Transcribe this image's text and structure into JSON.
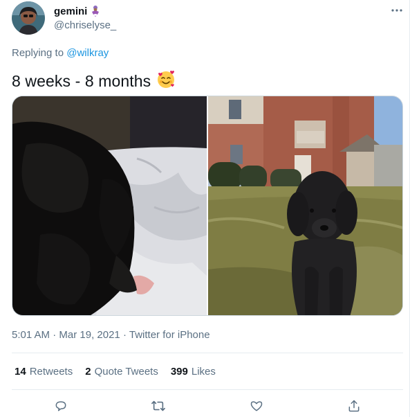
{
  "author": {
    "display_name": "gemini",
    "handle": "@chriselyse_",
    "name_emoji": "genie-emoji-icon"
  },
  "reply": {
    "prefix": "Replying to",
    "mention": "@wilkray"
  },
  "tweet": {
    "text": "8 weeks - 8 months",
    "emoji": "smiling-face-with-hearts-icon"
  },
  "media": {
    "photo_left": "black puppy lying on white bedding",
    "photo_right": "grown black doodle dog sitting on grass in front of brick apartment building"
  },
  "meta": {
    "time": "5:01 AM",
    "separator": "·",
    "date": "Mar 19, 2021",
    "source": "Twitter for iPhone"
  },
  "stats": {
    "retweets_num": "14",
    "retweets_label": "Retweets",
    "quotes_num": "2",
    "quotes_label": "Quote Tweets",
    "likes_num": "399",
    "likes_label": "Likes"
  },
  "colors": {
    "link": "#1b95e0",
    "secondary_text": "#5b7083",
    "primary_text": "#0f1419",
    "divider": "#e6ecf0"
  }
}
